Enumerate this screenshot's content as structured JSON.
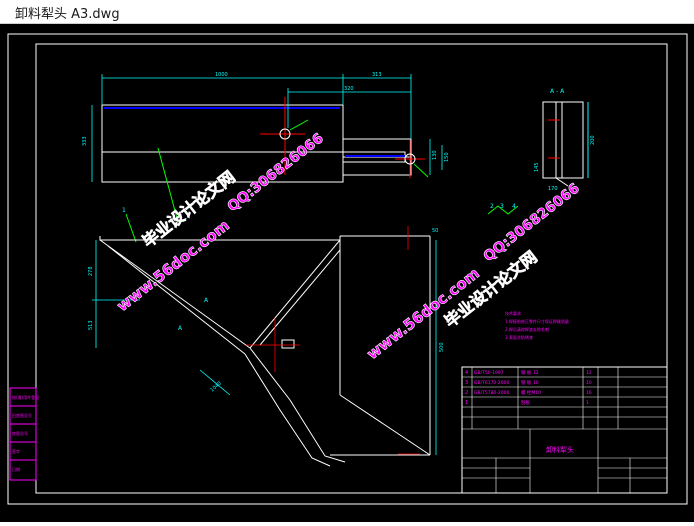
{
  "window": {
    "title": "卸料犁头 A3.dwg"
  },
  "drawing": {
    "top_dims": {
      "overall": "1000",
      "right_offset": "313",
      "inner_offset": "320",
      "height_left": "333",
      "tail_height_a": "130",
      "tail_height_b": "150"
    },
    "section": {
      "label": "A - A",
      "dim_side": "200",
      "dim_bottom_a": "145",
      "dim_bottom_b": "170"
    },
    "front_dims": {
      "left_a": "278",
      "left_b": "513",
      "right": "500",
      "diag": "1040",
      "top_right": "50"
    },
    "marks": {
      "section_mark": "A",
      "callout_1": "1",
      "callout_2": "2",
      "callout_3": "3",
      "callout_4": "4"
    },
    "notes": {
      "heading": "技术要求",
      "line1": "1.焊接前修正零件尺寸保证焊缝质量",
      "line2": "2.焊后清除焊渣去除毛刺",
      "line3": "3.表面涂防锈漆"
    },
    "title_block": {
      "name": "卸料犁头",
      "rows": [
        {
          "no": "4",
          "code": "GB/T50-1997",
          "name": "钢 板 12",
          "qty": "12"
        },
        {
          "no": "3",
          "code": "GB/T6170-2000",
          "name": "钢 板 10",
          "qty": "10"
        },
        {
          "no": "2",
          "code": "GB/T5780-2000",
          "name": "螺 栓M10",
          "qty": "16"
        },
        {
          "no": "1",
          "code": "",
          "name": "刮板",
          "qty": "1"
        }
      ]
    },
    "side_table": {
      "row1": "借(通)用件登记",
      "row2": "旧底图总号",
      "row3": "底图总号",
      "row4": "签字",
      "row5": "日期"
    }
  },
  "watermark": {
    "site": "www.56doc.com",
    "brand": "毕业设计论文网",
    "qq": "QQ:306826066"
  },
  "colors": {
    "canvas_bg": "#000000",
    "outline": "#ffffff",
    "dimension": "#00ffff",
    "centerline": "#ff0000",
    "hidden": "#0000ff",
    "leader": "#00ff00",
    "annotation": "#ff00ff",
    "watermark": "#ff00ff"
  }
}
